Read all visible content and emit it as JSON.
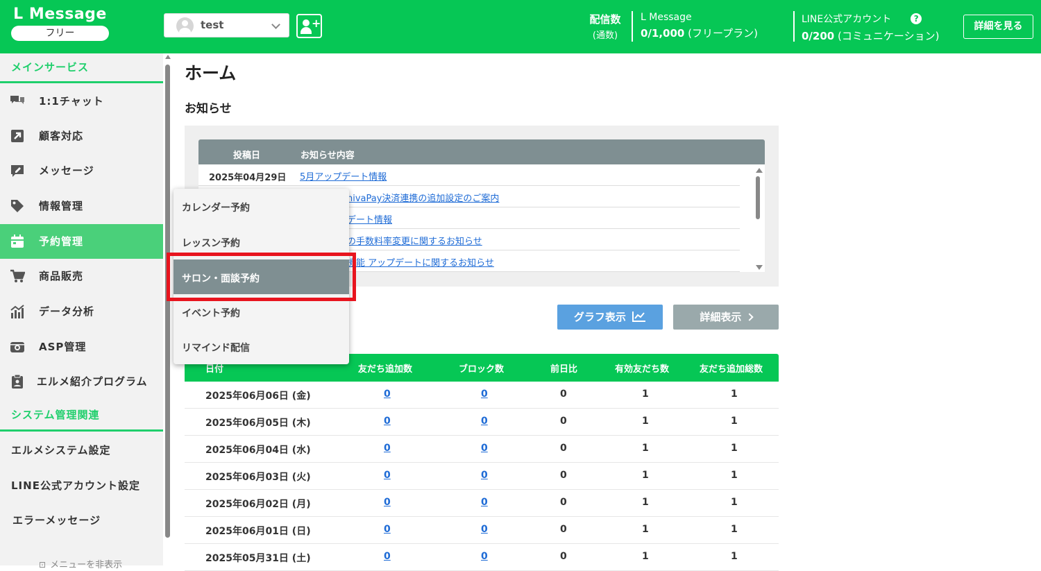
{
  "header": {
    "logo_title": "L Message",
    "plan_badge": "フリー",
    "account_name": "test",
    "stat_label_1": "配信数",
    "stat_label_2": "(通数)",
    "lmessage_label": "L Message",
    "lmessage_count": "0/1,000",
    "lmessage_plan": "(フリープラン)",
    "line_label": "LINE公式アカウント",
    "line_count": "0/200",
    "line_plan": "(コミュニケーション)",
    "help_glyph": "?",
    "detail_button": "詳細を見る"
  },
  "sidebar": {
    "main_section": "メインサービス",
    "items": [
      {
        "label": "1:1チャット",
        "icon": "chat-icon"
      },
      {
        "label": "顧客対応",
        "icon": "arrow-box-icon"
      },
      {
        "label": "メッセージ",
        "icon": "pen-message-icon"
      },
      {
        "label": "情報管理",
        "icon": "tag-icon"
      },
      {
        "label": "予約管理",
        "icon": "calendar-icon"
      },
      {
        "label": "商品販売",
        "icon": "cart-icon"
      },
      {
        "label": "データ分析",
        "icon": "chart-icon"
      },
      {
        "label": "ASP管理",
        "icon": "asp-icon"
      },
      {
        "label": "エルメ紹介プログラム",
        "icon": "clipboard-icon"
      }
    ],
    "system_section": "システム管理関連",
    "system_items": [
      "エルメシステム設定",
      "LINE公式アカウント設定",
      "エラーメッセージ"
    ],
    "hide_menu": "メニューを非表示"
  },
  "main": {
    "page_title": "ホーム",
    "news_title": "お知らせ",
    "news_headers": [
      "投稿日",
      "お知らせ内容"
    ],
    "news": [
      {
        "date": "2025年04月29日",
        "title": "5月アップデート情報"
      },
      {
        "date": "",
        "title": "hivaPay決済連携の追加設定のご案内"
      },
      {
        "date": "",
        "title": "デート情報"
      },
      {
        "date": "",
        "title": "の手数料率変更に関するお知らせ"
      },
      {
        "date": "",
        "title": "機能 アップデートに関するお知らせ"
      }
    ],
    "graph_button": "グラフ表示",
    "detail_button": "詳細表示",
    "table_headers": [
      "日付",
      "友だち追加数",
      "ブロック数",
      "前日比",
      "有効友だち数",
      "友だち追加総数"
    ],
    "rows": [
      {
        "date": "2025年06月06日 (金)",
        "add": "0",
        "block": "0",
        "diff": "0",
        "valid": "1",
        "total": "1"
      },
      {
        "date": "2025年06月05日 (木)",
        "add": "0",
        "block": "0",
        "diff": "0",
        "valid": "1",
        "total": "1"
      },
      {
        "date": "2025年06月04日 (水)",
        "add": "0",
        "block": "0",
        "diff": "0",
        "valid": "1",
        "total": "1"
      },
      {
        "date": "2025年06月03日 (火)",
        "add": "0",
        "block": "0",
        "diff": "0",
        "valid": "1",
        "total": "1"
      },
      {
        "date": "2025年06月02日 (月)",
        "add": "0",
        "block": "0",
        "diff": "0",
        "valid": "1",
        "total": "1"
      },
      {
        "date": "2025年06月01日 (日)",
        "add": "0",
        "block": "0",
        "diff": "0",
        "valid": "1",
        "total": "1"
      },
      {
        "date": "2025年05月31日 (土)",
        "add": "0",
        "block": "0",
        "diff": "0",
        "valid": "1",
        "total": "1"
      }
    ]
  },
  "dropdown": {
    "items": [
      "カレンダー予約",
      "レッスン予約",
      "サロン・面談予約",
      "イベント予約",
      "リマインド配信"
    ],
    "selected_index": 2
  },
  "colors": {
    "brand_green": "#06c755",
    "highlight_red": "#e8141e",
    "link_blue": "#1e6bd6"
  }
}
